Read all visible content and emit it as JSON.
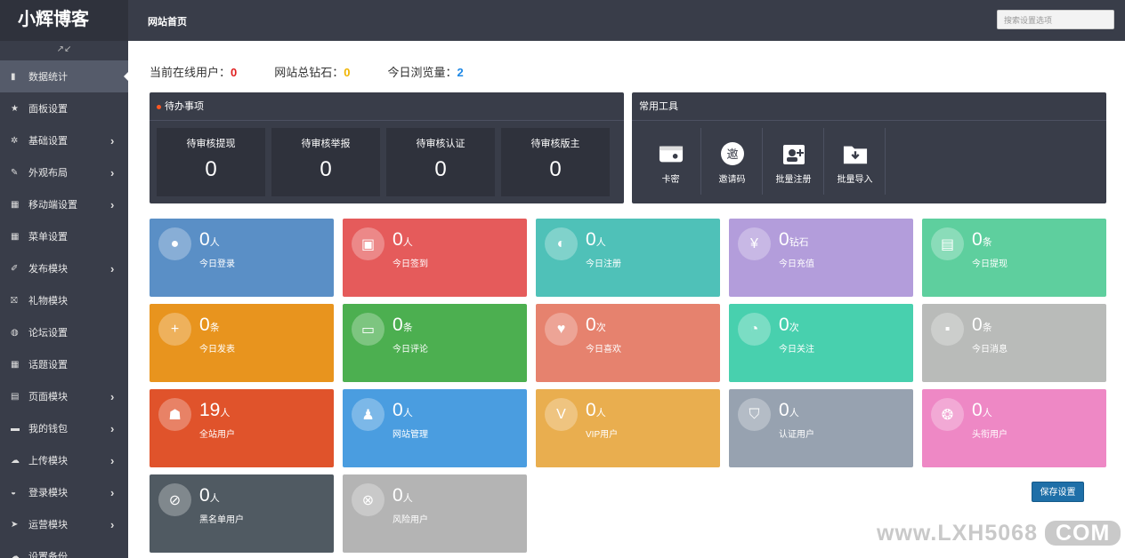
{
  "app": {
    "name": "小辉博客",
    "page_title": "网站首页",
    "search_placeholder": "搜索设置选项"
  },
  "sidebar": {
    "collapse_icon": "collapse-arrows-icon",
    "items": [
      {
        "label": "数据统计",
        "icon": "bar-chart-icon",
        "has_arrow": false,
        "active": true
      },
      {
        "label": "面板设置",
        "icon": "star-icon",
        "has_arrow": false
      },
      {
        "label": "基础设置",
        "icon": "gear-icon",
        "has_arrow": true
      },
      {
        "label": "外观布局",
        "icon": "brush-icon",
        "has_arrow": true
      },
      {
        "label": "移动端设置",
        "icon": "grid-icon",
        "has_arrow": true
      },
      {
        "label": "菜单设置",
        "icon": "grid-icon",
        "has_arrow": false
      },
      {
        "label": "发布模块",
        "icon": "edit-icon",
        "has_arrow": true
      },
      {
        "label": "礼物模块",
        "icon": "gift-icon",
        "has_arrow": false
      },
      {
        "label": "论坛设置",
        "icon": "chat-icon",
        "has_arrow": false
      },
      {
        "label": "话题设置",
        "icon": "grid-icon",
        "has_arrow": false
      },
      {
        "label": "页面模块",
        "icon": "file-icon",
        "has_arrow": true
      },
      {
        "label": "我的钱包",
        "icon": "folder-icon",
        "has_arrow": true
      },
      {
        "label": "上传模块",
        "icon": "cloud-upload-icon",
        "has_arrow": true
      },
      {
        "label": "登录模块",
        "icon": "bell-icon",
        "has_arrow": true
      },
      {
        "label": "运营模块",
        "icon": "send-icon",
        "has_arrow": true
      },
      {
        "label": "设置备份",
        "icon": "cloud-icon",
        "has_arrow": false
      }
    ]
  },
  "stats": {
    "online_label": "当前在线用户：",
    "online_value": "0",
    "diamond_label": "网站总钻石：",
    "diamond_value": "0",
    "views_label": "今日浏览量：",
    "views_value": "2"
  },
  "todo": {
    "title": "待办事项",
    "items": [
      {
        "label": "待审核提现",
        "value": "0"
      },
      {
        "label": "待审核举报",
        "value": "0"
      },
      {
        "label": "待审核认证",
        "value": "0"
      },
      {
        "label": "待审核版主",
        "value": "0"
      }
    ]
  },
  "tools": {
    "title": "常用工具",
    "items": [
      {
        "label": "卡密",
        "icon": "wallet-icon"
      },
      {
        "label": "邀请码",
        "icon": "invite-icon"
      },
      {
        "label": "批量注册",
        "icon": "add-user-icon"
      },
      {
        "label": "批量导入",
        "icon": "import-folder-icon"
      }
    ]
  },
  "cards": [
    {
      "value": "0",
      "unit": "人",
      "label": "今日登录",
      "color": "#5a8fc6",
      "icon": "user-icon"
    },
    {
      "value": "0",
      "unit": "人",
      "label": "今日签到",
      "color": "#e55b5b",
      "icon": "calendar-check-icon"
    },
    {
      "value": "0",
      "unit": "人",
      "label": "今日注册",
      "color": "#4fc1b8",
      "icon": "add-user-icon"
    },
    {
      "value": "0",
      "unit": "钻石",
      "label": "今日充值",
      "color": "#b39ddb",
      "icon": "yen-shield-icon"
    },
    {
      "value": "0",
      "unit": "条",
      "label": "今日提现",
      "color": "#5ecf9e",
      "icon": "cash-icon"
    },
    {
      "value": "0",
      "unit": "条",
      "label": "今日发表",
      "color": "#e8941e",
      "icon": "plus-icon"
    },
    {
      "value": "0",
      "unit": "条",
      "label": "今日评论",
      "color": "#4caf50",
      "icon": "comment-icon"
    },
    {
      "value": "0",
      "unit": "次",
      "label": "今日喜欢",
      "color": "#e6826e",
      "icon": "heart-icon"
    },
    {
      "value": "0",
      "unit": "次",
      "label": "今日关注",
      "color": "#48d0ae",
      "icon": "follow-icon"
    },
    {
      "value": "0",
      "unit": "条",
      "label": "今日消息",
      "color": "#b9bbb9",
      "icon": "message-icon"
    },
    {
      "value": "19",
      "unit": "人",
      "label": "全站用户",
      "color": "#e0532b",
      "icon": "users-icon"
    },
    {
      "value": "0",
      "unit": "人",
      "label": "网站管理",
      "color": "#4a9de0",
      "icon": "admin-icon"
    },
    {
      "value": "0",
      "unit": "人",
      "label": "VIP用户",
      "color": "#e9ae4f",
      "icon": "vip-icon"
    },
    {
      "value": "0",
      "unit": "人",
      "label": "认证用户",
      "color": "#97a2b0",
      "icon": "shield-icon"
    },
    {
      "value": "0",
      "unit": "人",
      "label": "头衔用户",
      "color": "#ee88c5",
      "icon": "medal-icon"
    },
    {
      "value": "0",
      "unit": "人",
      "label": "黑名单用户",
      "color": "#505a62",
      "icon": "blocked-user-icon"
    },
    {
      "value": "0",
      "unit": "人",
      "label": "风险用户",
      "color": "#b4b4b4",
      "icon": "risk-user-icon"
    }
  ],
  "save_label": "保存设置",
  "watermark": {
    "main": "www.LXH5068",
    "badge": "COM"
  }
}
